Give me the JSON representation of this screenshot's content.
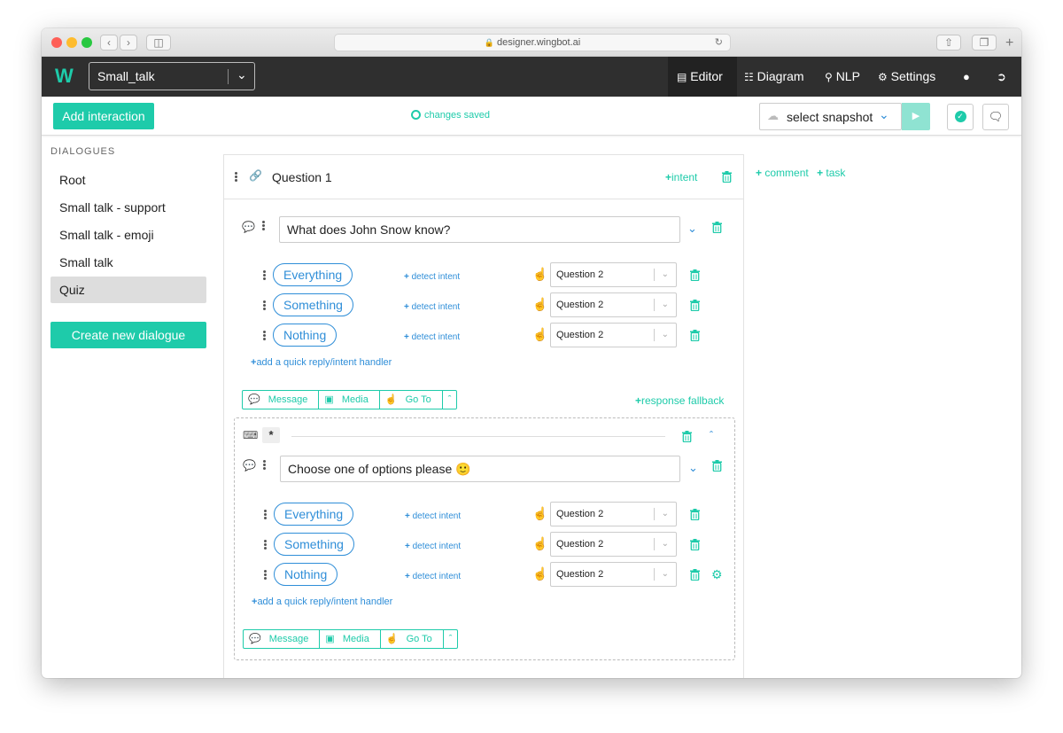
{
  "browser": {
    "url": "designer.wingbot.ai"
  },
  "topbar": {
    "logo": "W",
    "bot_selector": "Small_talk",
    "nav": {
      "editor": "Editor",
      "diagram": "Diagram",
      "nlp": "NLP",
      "settings": "Settings"
    }
  },
  "toolbar": {
    "add_interaction": "Add interaction",
    "status": "changes saved",
    "snapshot_placeholder": "select snapshot"
  },
  "sidebar": {
    "heading": "DIALOGUES",
    "items": [
      {
        "label": "Root",
        "active": false
      },
      {
        "label": "Small talk - support",
        "active": false
      },
      {
        "label": "Small talk - emoji",
        "active": false
      },
      {
        "label": "Small talk",
        "active": false
      },
      {
        "label": "Quiz",
        "active": true
      }
    ],
    "create_button": "Create new dialogue"
  },
  "interaction": {
    "title": "Question 1",
    "add_intent": "intent",
    "comment": "comment",
    "task": "task",
    "responses": [
      {
        "message": "What does John Snow know?",
        "replies": [
          {
            "label": "Everything",
            "detect": "detect intent",
            "target": "Question 2"
          },
          {
            "label": "Something",
            "detect": "detect intent",
            "target": "Question 2"
          },
          {
            "label": "Nothing",
            "detect": "detect intent",
            "target": "Question 2"
          }
        ],
        "add_reply": "add a quick reply/intent handler",
        "tools": [
          "Message",
          "Media",
          "Go To"
        ],
        "fallback": "response fallback"
      },
      {
        "condition": "*",
        "message": "Choose one of options please 🙂",
        "replies": [
          {
            "label": "Everything",
            "detect": "detect intent",
            "target": "Question 2"
          },
          {
            "label": "Something",
            "detect": "detect intent",
            "target": "Question 2"
          },
          {
            "label": "Nothing",
            "detect": "detect intent",
            "target": "Question 2"
          }
        ],
        "add_reply": "add a quick reply/intent handler",
        "tools": [
          "Message",
          "Media",
          "Go To"
        ]
      }
    ]
  },
  "colors": {
    "accent": "#1ecbaa",
    "link": "#2f8ed8",
    "nav_bg": "#2f2f2f"
  }
}
